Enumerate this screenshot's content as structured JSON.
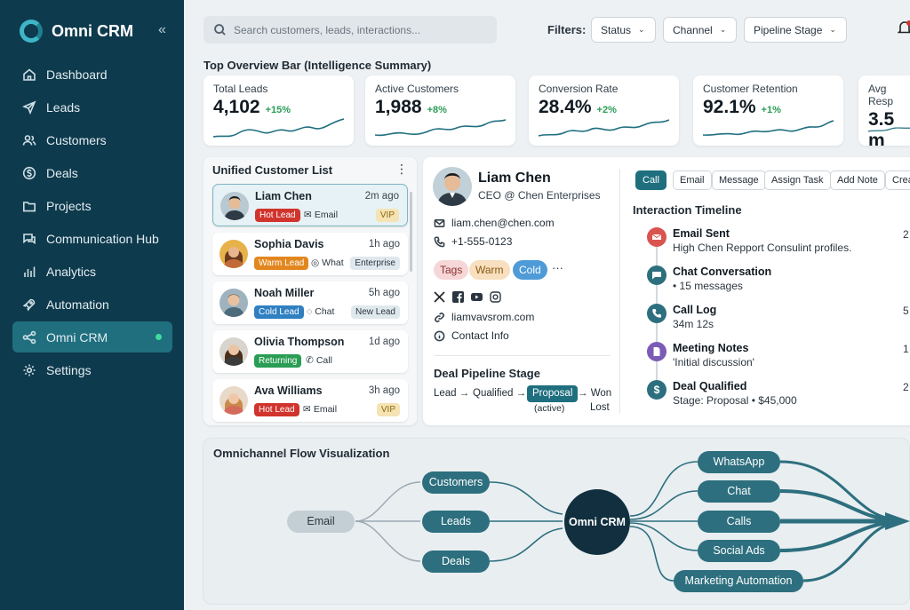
{
  "brand": {
    "name": "Omni CRM"
  },
  "sidebar": {
    "items": [
      {
        "label": "Dashboard",
        "icon": "home-icon"
      },
      {
        "label": "Leads",
        "icon": "send-icon"
      },
      {
        "label": "Customers",
        "icon": "users-icon"
      },
      {
        "label": "Deals",
        "icon": "dollar-icon"
      },
      {
        "label": "Projects",
        "icon": "folder-icon"
      },
      {
        "label": "Communication Hub",
        "icon": "chat-icon"
      },
      {
        "label": "Analytics",
        "icon": "bar-chart-icon"
      },
      {
        "label": "Automation",
        "icon": "rocket-icon"
      },
      {
        "label": "Omni CRM",
        "icon": "share-icon",
        "active": true
      },
      {
        "label": "Settings",
        "icon": "gear-icon"
      }
    ]
  },
  "search": {
    "placeholder": "Search customers, leads, interactions..."
  },
  "filters": {
    "label": "Filters:",
    "items": [
      "Status",
      "Channel",
      "Pipeline Stage"
    ]
  },
  "overview": {
    "title": "Top Overview Bar (Intelligence Summary)",
    "kpis": [
      {
        "label": "Total Leads",
        "value": "4,102",
        "delta": "+15%"
      },
      {
        "label": "Active Customers",
        "value": "1,988",
        "delta": "+8%"
      },
      {
        "label": "Conversion Rate",
        "value": "28.4%",
        "delta": "+2%"
      },
      {
        "label": "Customer Retention",
        "value": "92.1%",
        "delta": "+1%"
      },
      {
        "label": "Avg Resp",
        "value": "3.5 m",
        "delta": ""
      }
    ]
  },
  "customer_list": {
    "title": "Unified Customer List",
    "items": [
      {
        "name": "Liam Chen",
        "time": "2m ago",
        "tag": "Hot Lead",
        "channel": "Email",
        "badge": "VIP"
      },
      {
        "name": "Sophia Davis",
        "time": "1h ago",
        "tag": "Warm Lead",
        "channel": "What",
        "badge": "Enterprise"
      },
      {
        "name": "Noah Miller",
        "time": "5h ago",
        "tag": "Cold Lead",
        "channel": "Chat",
        "badge": "New Lead"
      },
      {
        "name": "Olivia Thompson",
        "time": "1d ago",
        "tag": "Returning",
        "channel": "Call",
        "badge": ""
      },
      {
        "name": "Ava Williams",
        "time": "3h ago",
        "tag": "Hot Lead",
        "channel": "Email",
        "badge": "VIP"
      }
    ]
  },
  "contact": {
    "name": "Liam Chen",
    "role": "CEO @ Chen Enterprises",
    "email": "liam.chen@chen.com",
    "phone": "+1-555-0123",
    "tags": [
      "Tags",
      "Warm",
      "Cold"
    ],
    "more": "···",
    "website": "liamvavsrom.com",
    "info": "Contact Info",
    "pipeline": {
      "title": "Deal Pipeline Stage",
      "lead": "Lead →",
      "qualified": "Qualified →",
      "proposal": "Proposal",
      "active": "(active)",
      "won": "→ Won",
      "lost": "Lost"
    }
  },
  "actions": [
    "Call",
    "Email",
    "Message",
    "Assign Task",
    "Add Note",
    "Crea"
  ],
  "timeline": {
    "title": "Interaction Timeline",
    "items": [
      {
        "title": "Email Sent",
        "desc": "High Chen Repport Consulint profiles.",
        "num": "2",
        "color": "#d9534f"
      },
      {
        "title": "Chat Conversation",
        "desc": "• 15 messages",
        "num": "",
        "color": "#2d6f7e"
      },
      {
        "title": "Call Log",
        "desc": "34m 12s",
        "num": "5",
        "color": "#2d6f7e"
      },
      {
        "title": "Meeting Notes",
        "desc": "'Initial discussion'",
        "num": "1",
        "color": "#7b5bb5"
      },
      {
        "title": "Deal Qualified",
        "desc": "Stage: Proposal • $45,000",
        "num": "2",
        "color": "#2d6f7e"
      }
    ]
  },
  "flow": {
    "title": "Omnichannel Flow Visualization",
    "source": "Email",
    "mids": [
      "Customers",
      "Leads",
      "Deals"
    ],
    "hub": "Omni CRM",
    "outputs": [
      "WhatsApp",
      "Chat",
      "Calls",
      "Social Ads",
      "Marketing Automation"
    ]
  },
  "colors": {
    "sidebar": "#0e3a4d",
    "accent": "#1f6f7f",
    "positive": "#2a9d55",
    "hot": "#d0342c",
    "warm": "#e2871f",
    "cold": "#2f7fc1",
    "returning": "#2a9d55"
  }
}
